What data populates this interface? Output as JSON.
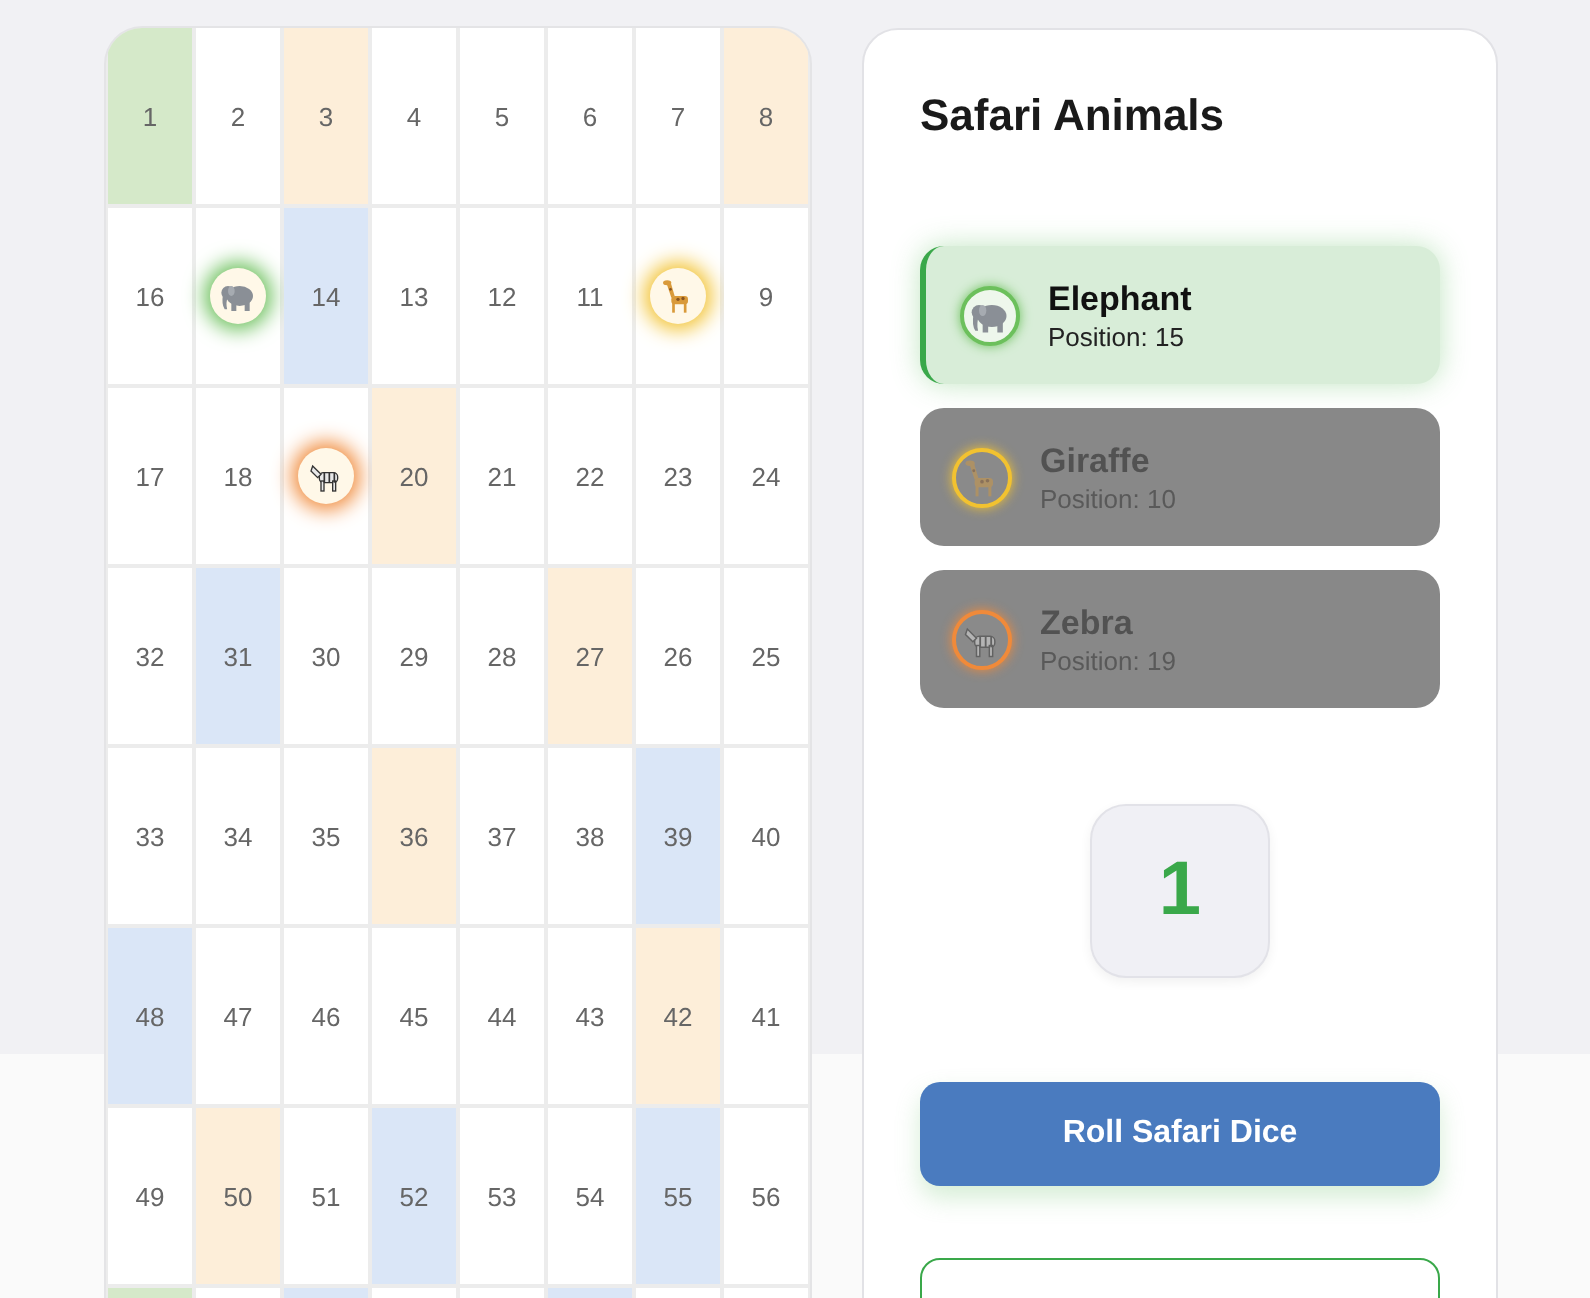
{
  "board": {
    "rows": [
      [
        {
          "number": "1",
          "color": "#d5e9c9"
        },
        {
          "number": "2"
        },
        {
          "number": "3",
          "color": "#fdeed9"
        },
        {
          "number": "4"
        },
        {
          "number": "5"
        },
        {
          "number": "6"
        },
        {
          "number": "7"
        },
        {
          "number": "8",
          "color": "#fdeed9"
        }
      ],
      [
        {
          "number": "16"
        },
        {
          "kind": "elephant"
        },
        {
          "number": "14",
          "color": "#dae6f7"
        },
        {
          "number": "13"
        },
        {
          "number": "12"
        },
        {
          "number": "11"
        },
        {
          "kind": "giraffe"
        },
        {
          "number": "9"
        }
      ],
      [
        {
          "number": "17"
        },
        {
          "number": "18"
        },
        {
          "kind": "zebra"
        },
        {
          "number": "20",
          "color": "#fdeed9"
        },
        {
          "number": "21"
        },
        {
          "number": "22"
        },
        {
          "number": "23"
        },
        {
          "number": "24"
        }
      ],
      [
        {
          "number": "32"
        },
        {
          "number": "31",
          "color": "#dae6f7"
        },
        {
          "number": "30"
        },
        {
          "number": "29"
        },
        {
          "number": "28"
        },
        {
          "number": "27",
          "color": "#fdeed9"
        },
        {
          "number": "26"
        },
        {
          "number": "25"
        }
      ],
      [
        {
          "number": "33"
        },
        {
          "number": "34"
        },
        {
          "number": "35"
        },
        {
          "number": "36",
          "color": "#fdeed9"
        },
        {
          "number": "37"
        },
        {
          "number": "38"
        },
        {
          "number": "39",
          "color": "#dae6f7"
        },
        {
          "number": "40"
        }
      ],
      [
        {
          "number": "48",
          "color": "#dae6f7"
        },
        {
          "number": "47"
        },
        {
          "number": "46"
        },
        {
          "number": "45"
        },
        {
          "number": "44"
        },
        {
          "number": "43"
        },
        {
          "number": "42",
          "color": "#fdeed9"
        },
        {
          "number": "41"
        }
      ],
      [
        {
          "number": "49"
        },
        {
          "number": "50",
          "color": "#fdeed9"
        },
        {
          "number": "51"
        },
        {
          "number": "52",
          "color": "#dae6f7"
        },
        {
          "number": "53"
        },
        {
          "number": "54"
        },
        {
          "number": "55",
          "color": "#dae6f7"
        },
        {
          "number": "56"
        }
      ],
      [
        {
          "color": "#d5e9c9"
        },
        {},
        {
          "color": "#dae6f7"
        },
        {},
        {},
        {
          "color": "#dae6f7"
        },
        {},
        {}
      ]
    ]
  },
  "panel": {
    "title": "Safari Animals",
    "players": [
      {
        "kind": "elephant",
        "name": "Elephant",
        "position": "Position: 15",
        "color": "#6cc05c",
        "selected": true
      },
      {
        "kind": "giraffe",
        "name": "Giraffe",
        "position": "Position: 10",
        "color": "#f2c230",
        "selected": false
      },
      {
        "kind": "zebra",
        "name": "Zebra",
        "position": "Position: 19",
        "color": "#f08a3a",
        "selected": false
      }
    ],
    "dice": "1",
    "roll_button": "Roll Safari Dice"
  }
}
